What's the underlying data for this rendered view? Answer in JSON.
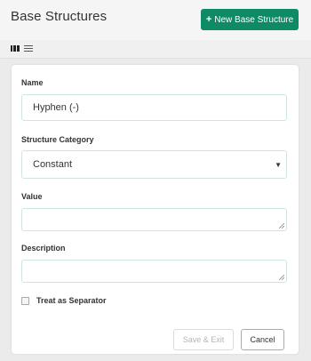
{
  "header": {
    "title": "Base Structures",
    "new_button_icon": "+",
    "new_button_label": "New Base Structure"
  },
  "view_toggles": {
    "grid": "grid-view-icon",
    "list": "list-view-icon"
  },
  "form": {
    "name": {
      "label": "Name",
      "value": "Hyphen (-)"
    },
    "category": {
      "label": "Structure Category",
      "value": "Constant"
    },
    "value": {
      "label": "Value",
      "value": ""
    },
    "description": {
      "label": "Description",
      "value": ""
    },
    "separator": {
      "label": "Treat as Separator",
      "checked": false
    },
    "save_label": "Save & Exit",
    "cancel_label": "Cancel"
  },
  "colors": {
    "accent": "#0f8a66",
    "field_border": "#cfe6df",
    "background": "#ebebeb"
  }
}
